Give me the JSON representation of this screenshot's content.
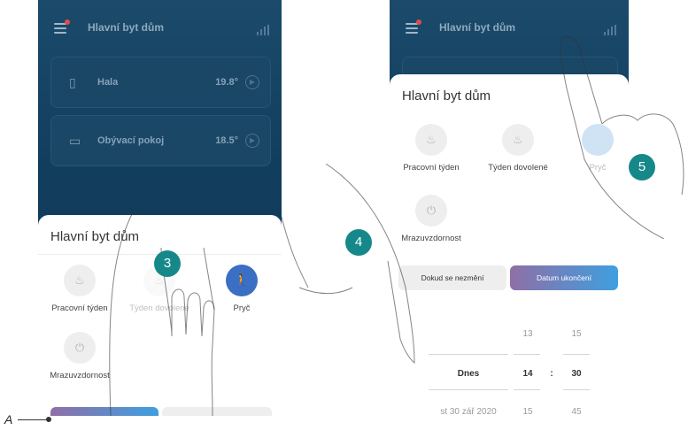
{
  "app_title": "Hlavní byt dům",
  "rooms": [
    {
      "name": "Hala",
      "temp": "19.8°"
    },
    {
      "name": "Obývací pokoj",
      "temp": "18.5°"
    }
  ],
  "sheet": {
    "title": "Hlavní byt dům",
    "modes": [
      "Pracovní týden",
      "Týden dovolené",
      "Pryč",
      "Mrazuvzdornost"
    ],
    "modes_partial": {
      "away_partial": "Pryč"
    }
  },
  "toggle": {
    "until_changed": "Dokud se nezmění",
    "end_date": "Datum ukončení"
  },
  "picker": {
    "prev": {
      "day": "",
      "hour": "13",
      "minute": "15"
    },
    "current": {
      "day": "Dnes",
      "hour": "14",
      "minute": "30"
    },
    "next": {
      "day": "st 30 zář 2020",
      "hour": "15",
      "minute": "45"
    },
    "separator": ":"
  },
  "steps": [
    "3",
    "4",
    "5"
  ],
  "callout": {
    "letter": "A"
  },
  "colors": {
    "teal_badge": "#16888a",
    "active_blue": "#3a6fc4",
    "toggle_gradient_start": "#8f6fa6",
    "toggle_gradient_end": "#3f9fe0"
  },
  "icons": {
    "menu": "menu-icon",
    "signal": "signal-icon",
    "door": "door-icon",
    "sofa": "sofa-icon",
    "flame": "flame-icon",
    "power": "power-icon",
    "walk": "walking-person-icon"
  }
}
